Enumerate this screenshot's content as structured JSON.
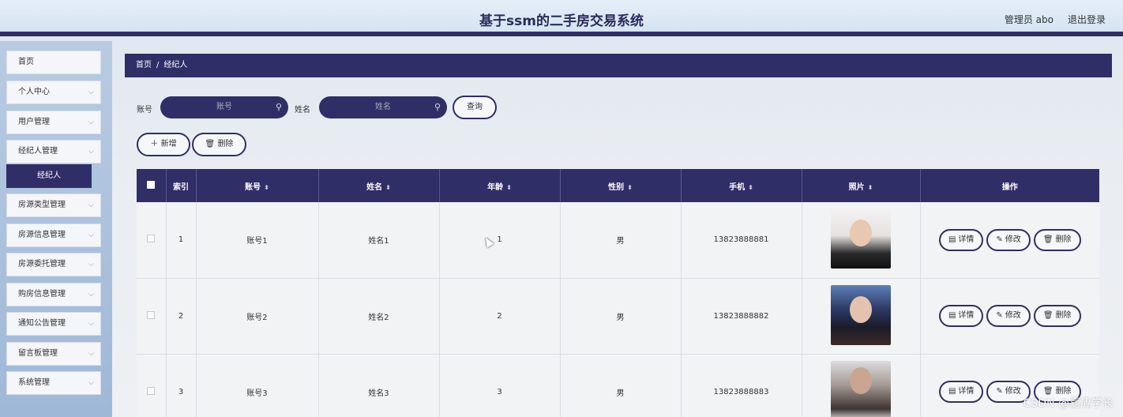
{
  "header": {
    "title": "基于ssm的二手房交易系统",
    "admin_label": "管理员 abo",
    "logout_label": "退出登录"
  },
  "sidebar": {
    "items": [
      {
        "label": "首页"
      },
      {
        "label": "个人中心"
      },
      {
        "label": "用户管理"
      },
      {
        "label": "经纪人管理"
      },
      {
        "label": "房源类型管理"
      },
      {
        "label": "房源信息管理"
      },
      {
        "label": "房源委托管理"
      },
      {
        "label": "购房信息管理"
      },
      {
        "label": "通知公告管理"
      },
      {
        "label": "留言板管理"
      },
      {
        "label": "系统管理"
      }
    ],
    "active_sub": "经纪人"
  },
  "breadcrumb": {
    "home": "首页",
    "separator": "/",
    "current": "经纪人"
  },
  "search": {
    "account_label": "账号",
    "account_placeholder": "账号",
    "name_label": "姓名",
    "name_placeholder": "姓名",
    "query_button": "查询"
  },
  "actions": {
    "add_label": "新增",
    "delete_label": "删除"
  },
  "table": {
    "headers": [
      "索引",
      "账号",
      "姓名",
      "年龄",
      "性别",
      "手机",
      "照片",
      "操作"
    ],
    "rows": [
      {
        "index": "1",
        "account": "账号1",
        "name": "姓名1",
        "age": "1",
        "gender": "男",
        "phone": "13823888881"
      },
      {
        "index": "2",
        "account": "账号2",
        "name": "姓名2",
        "age": "2",
        "gender": "男",
        "phone": "13823888882"
      },
      {
        "index": "3",
        "account": "账号3",
        "name": "姓名3",
        "age": "3",
        "gender": "男",
        "phone": "13823888883"
      }
    ],
    "row_actions": {
      "detail": "详情",
      "edit": "修改",
      "delete": "删除"
    }
  },
  "watermark": "CSDN @嘉应学长",
  "colors": {
    "primary": "#302e66",
    "header_bg": "#dbe7f4",
    "sidebar_bg": "#a9c0dd"
  },
  "icons": {
    "search": "magnifier-icon",
    "sort": "sort-icon",
    "chevron": "chevron-down-icon"
  }
}
